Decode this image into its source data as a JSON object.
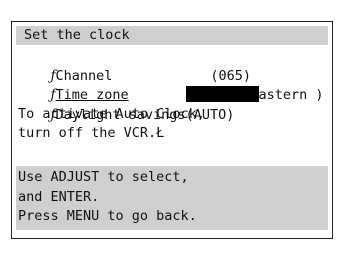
{
  "menu": {
    "title": "Set the clock",
    "marker": "ƒ",
    "items": [
      {
        "label": "Channel",
        "value": "(065)"
      },
      {
        "label": "Time zone",
        "value": "astern )"
      },
      {
        "label": "Daylight savings(AUTO)",
        "value": ""
      }
    ],
    "info_line1": "To activate Auto Clock,",
    "info_line2": "turn off the VCR.Ł"
  },
  "help": {
    "line1": "Use ADJUST to select,",
    "line2": "and ENTER.",
    "line3": "Press MENU to go back."
  }
}
